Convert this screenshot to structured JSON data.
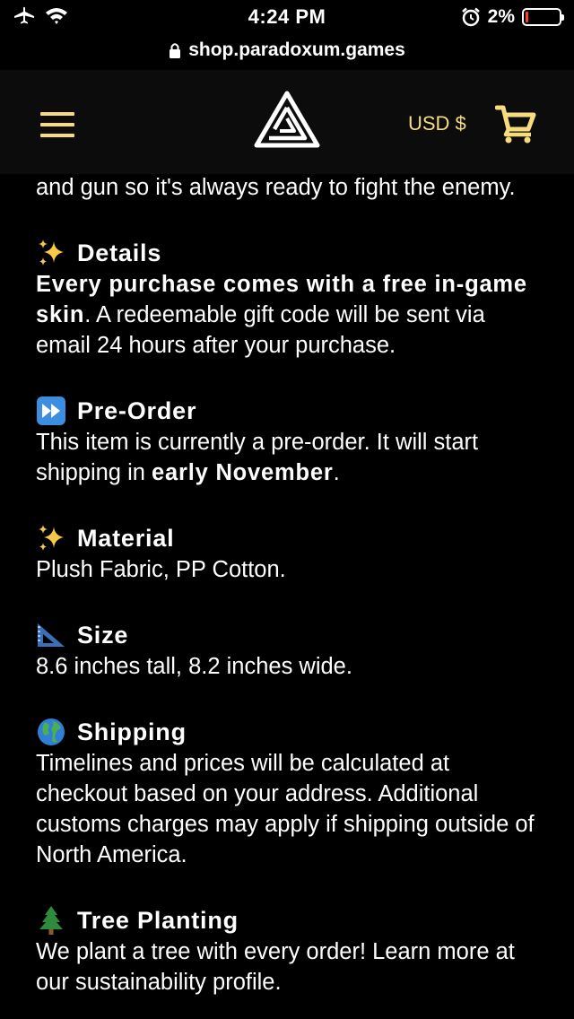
{
  "status_bar": {
    "time": "4:24 PM",
    "battery_percent": "2%",
    "battery_level": 0.02,
    "icons": [
      "airplane-mode-icon",
      "wifi-icon",
      "alarm-icon",
      "battery-icon"
    ]
  },
  "browser": {
    "url": "shop.paradoxum.games",
    "secure_icon": "lock-icon"
  },
  "header": {
    "menu_icon": "hamburger-menu-icon",
    "logo": "paradoxum-logo",
    "currency_label": "USD $",
    "cart_icon": "cart-icon",
    "accent_color": "#f6dc7d"
  },
  "content": {
    "intro_text": "and gun so it's always ready to fight the enemy.",
    "sections": [
      {
        "emoji": "sparkles",
        "title": "Details",
        "body_bold": "Every purchase comes with a free in-game skin",
        "body_rest": ". A redeemable gift code will be sent via email 24 hours after your purchase."
      },
      {
        "emoji": "fast-forward",
        "title": "Pre-Order",
        "body_before": "This item is currently a pre-order. It will start shipping in ",
        "body_bold": "early November",
        "body_after": "."
      },
      {
        "emoji": "sparkles",
        "title": "Material",
        "body": "Plush Fabric, PP Cotton."
      },
      {
        "emoji": "triangular-ruler",
        "title": "Size",
        "body": "8.6 inches tall, 8.2 inches wide."
      },
      {
        "emoji": "globe",
        "title": "Shipping",
        "body": "Timelines and prices will be calculated at checkout based on your address. Additional customs charges may apply if shipping outside of North America."
      },
      {
        "emoji": "evergreen-tree",
        "title": "Tree Planting",
        "body": "We plant a tree with every order! Learn more at our sustainability profile."
      }
    ]
  }
}
